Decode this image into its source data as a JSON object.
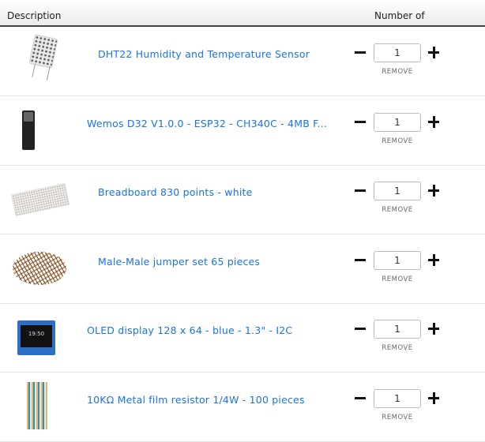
{
  "header": {
    "description": "Description",
    "number_of": "Number of"
  },
  "remove_label": "REMOVE",
  "items": [
    {
      "name": "DHT22 Humidity and Temperature Sensor",
      "quantity": "1",
      "image": "dht22-sensor"
    },
    {
      "name": "Wemos D32 V1.0.0 - ESP32 - CH340C - 4MB F...",
      "quantity": "1",
      "image": "wemos-board"
    },
    {
      "name": "Breadboard 830 points - white",
      "quantity": "1",
      "image": "breadboard"
    },
    {
      "name": "Male-Male jumper set 65 pieces",
      "quantity": "1",
      "image": "jumper-wires"
    },
    {
      "name": "OLED display 128 x 64 - blue - 1.3\" - I2C",
      "quantity": "1",
      "image": "oled-display"
    },
    {
      "name": "10KΩ Metal film resistor 1/4W - 100 pieces",
      "quantity": "1",
      "image": "resistors"
    }
  ],
  "colors": {
    "link": "#1a73e8",
    "header_border": "#444444"
  }
}
